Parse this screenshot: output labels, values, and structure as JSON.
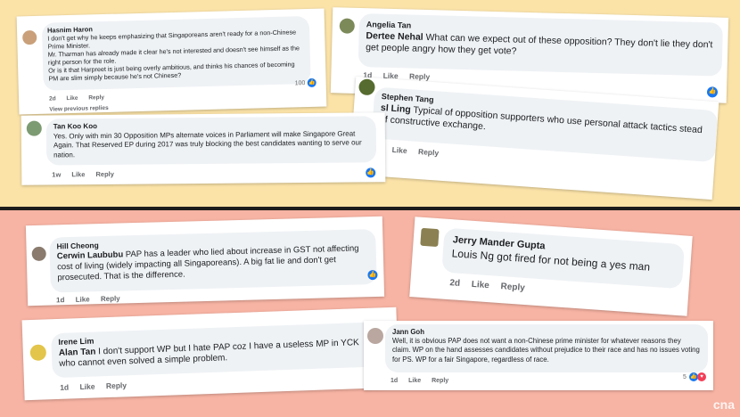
{
  "comments": {
    "hasnim": {
      "name": "Hasnim Haron",
      "line1": "I don't get why he keeps emphasizing that Singaporeans aren't ready for a non-Chinese Prime Minister.",
      "line2": "Mr. Tharman has already made it clear he's not interested and doesn't see himself as the right person for the role.",
      "line3": "Or is it that Harpreet is just being overly ambitious, and thinks his chances of becoming PM are slim simply because he's not Chinese?",
      "time": "2d",
      "like": "Like",
      "reply": "Reply",
      "reactions": "100",
      "more": "View previous replies"
    },
    "angelia": {
      "name": "Angelia Tan",
      "reply_to": "Dertee Nehal",
      "text": " What can we expect out of these opposition? They don't lie they don't get people angry how they get vote?",
      "time": "1d",
      "like": "Like",
      "reply": "Reply"
    },
    "tankoo": {
      "name": "Tan Koo Koo",
      "text": "Yes. Only with min 30 Opposition MPs alternate voices in Parliament will make Singapore Great Again. That Reserved EP during 2017 was truly blocking the best candidates wanting to serve our nation.",
      "time": "1w",
      "like": "Like",
      "reply": "Reply"
    },
    "stephen": {
      "name": "Stephen Tang",
      "reply_to": "sl Ling",
      "text": " Typical of opposition supporters who use personal attack tactics stead of constructive exchange.",
      "like": "Like",
      "reply": "Reply"
    },
    "hill": {
      "name": "Hill Cheong",
      "reply_to": "Cerwin Laububu",
      "text": " PAP has a leader who lied about increase in GST not affecting cost of living (widely impacting all Singaporeans). A big fat lie and don't get prosecuted. That is the difference.",
      "time": "1d",
      "like": "Like",
      "reply": "Reply"
    },
    "jerry": {
      "name": "Jerry Mander Gupta",
      "text": "Louis Ng got fired for not being a yes man",
      "time": "2d",
      "like": "Like",
      "reply": "Reply"
    },
    "irene": {
      "name": "Irene Lim",
      "reply_to": "Alan Tan",
      "text": " I don't support WP but I hate PAP coz I have a useless MP in YCK who cannot even solved a simple problem.",
      "time": "1d",
      "like": "Like",
      "reply": "Reply"
    },
    "jann": {
      "name": "Jann Goh",
      "text": "Well, it is obvious PAP does not want a non-Chinese prime minister for whatever reasons they claim. WP on the hand assesses candidates without prejudice to their race and has no issues voting for PS. WP for a fair Singapore, regardless of race.",
      "time": "1d",
      "like": "Like",
      "reply": "Reply",
      "reactions": "5"
    }
  },
  "logo": "cna",
  "colors": {
    "top_bg": "#fbe3a8",
    "bottom_bg": "#f7b3a3",
    "like_blue": "#1877f2"
  }
}
